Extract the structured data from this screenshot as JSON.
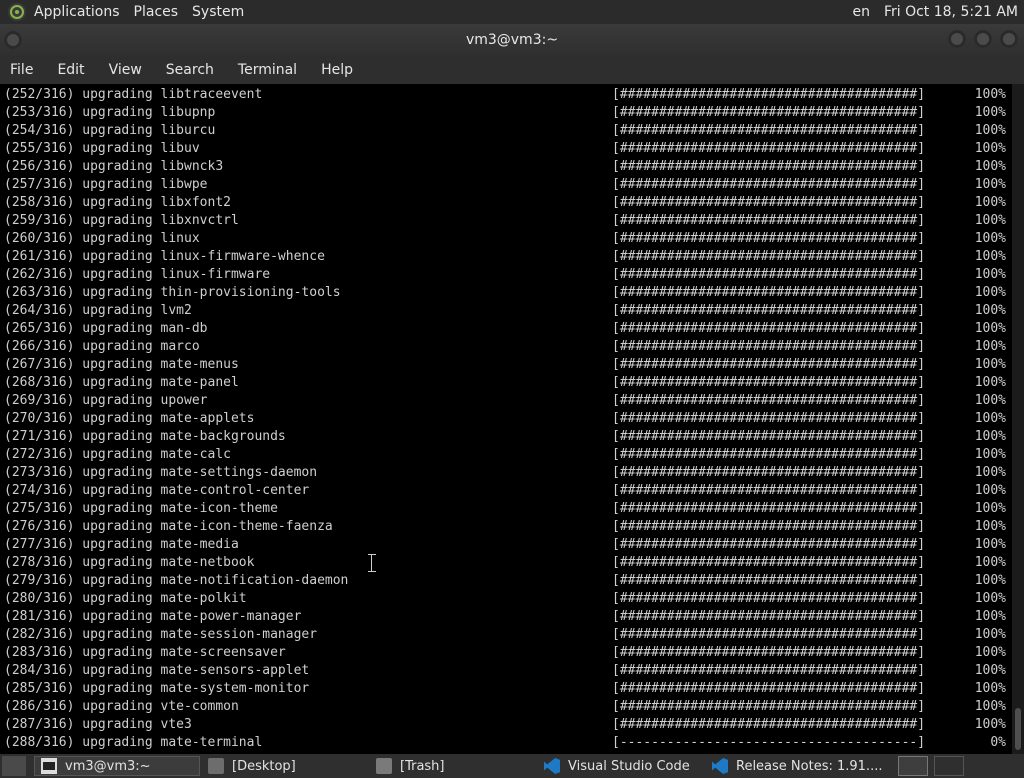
{
  "top_panel": {
    "menus": [
      "Applications",
      "Places",
      "System"
    ],
    "keyboard_layout": "en",
    "clock": "Fri Oct 18, 5:21 AM"
  },
  "window": {
    "title": "vm3@vm3:~"
  },
  "menubar": [
    "File",
    "Edit",
    "View",
    "Search",
    "Terminal",
    "Help"
  ],
  "terminal": {
    "lines": [
      {
        "text": "(252/316) upgrading libtraceevent",
        "bar": "[######################################]",
        "pct": "100%"
      },
      {
        "text": "(253/316) upgrading libupnp",
        "bar": "[######################################]",
        "pct": "100%"
      },
      {
        "text": "(254/316) upgrading liburcu",
        "bar": "[######################################]",
        "pct": "100%"
      },
      {
        "text": "(255/316) upgrading libuv",
        "bar": "[######################################]",
        "pct": "100%"
      },
      {
        "text": "(256/316) upgrading libwnck3",
        "bar": "[######################################]",
        "pct": "100%"
      },
      {
        "text": "(257/316) upgrading libwpe",
        "bar": "[######################################]",
        "pct": "100%"
      },
      {
        "text": "(258/316) upgrading libxfont2",
        "bar": "[######################################]",
        "pct": "100%"
      },
      {
        "text": "(259/316) upgrading libxnvctrl",
        "bar": "[######################################]",
        "pct": "100%"
      },
      {
        "text": "(260/316) upgrading linux",
        "bar": "[######################################]",
        "pct": "100%"
      },
      {
        "text": "(261/316) upgrading linux-firmware-whence",
        "bar": "[######################################]",
        "pct": "100%"
      },
      {
        "text": "(262/316) upgrading linux-firmware",
        "bar": "[######################################]",
        "pct": "100%"
      },
      {
        "text": "(263/316) upgrading thin-provisioning-tools",
        "bar": "[######################################]",
        "pct": "100%"
      },
      {
        "text": "(264/316) upgrading lvm2",
        "bar": "[######################################]",
        "pct": "100%"
      },
      {
        "text": "(265/316) upgrading man-db",
        "bar": "[######################################]",
        "pct": "100%"
      },
      {
        "text": "(266/316) upgrading marco",
        "bar": "[######################################]",
        "pct": "100%"
      },
      {
        "text": "(267/316) upgrading mate-menus",
        "bar": "[######################################]",
        "pct": "100%"
      },
      {
        "text": "(268/316) upgrading mate-panel",
        "bar": "[######################################]",
        "pct": "100%"
      },
      {
        "text": "(269/316) upgrading upower",
        "bar": "[######################################]",
        "pct": "100%"
      },
      {
        "text": "(270/316) upgrading mate-applets",
        "bar": "[######################################]",
        "pct": "100%"
      },
      {
        "text": "(271/316) upgrading mate-backgrounds",
        "bar": "[######################################]",
        "pct": "100%"
      },
      {
        "text": "(272/316) upgrading mate-calc",
        "bar": "[######################################]",
        "pct": "100%"
      },
      {
        "text": "(273/316) upgrading mate-settings-daemon",
        "bar": "[######################################]",
        "pct": "100%"
      },
      {
        "text": "(274/316) upgrading mate-control-center",
        "bar": "[######################################]",
        "pct": "100%"
      },
      {
        "text": "(275/316) upgrading mate-icon-theme",
        "bar": "[######################################]",
        "pct": "100%"
      },
      {
        "text": "(276/316) upgrading mate-icon-theme-faenza",
        "bar": "[######################################]",
        "pct": "100%"
      },
      {
        "text": "(277/316) upgrading mate-media",
        "bar": "[######################################]",
        "pct": "100%"
      },
      {
        "text": "(278/316) upgrading mate-netbook",
        "bar": "[######################################]",
        "pct": "100%"
      },
      {
        "text": "(279/316) upgrading mate-notification-daemon",
        "bar": "[######################################]",
        "pct": "100%"
      },
      {
        "text": "(280/316) upgrading mate-polkit",
        "bar": "[######################################]",
        "pct": "100%"
      },
      {
        "text": "(281/316) upgrading mate-power-manager",
        "bar": "[######################################]",
        "pct": "100%"
      },
      {
        "text": "(282/316) upgrading mate-session-manager",
        "bar": "[######################################]",
        "pct": "100%"
      },
      {
        "text": "(283/316) upgrading mate-screensaver",
        "bar": "[######################################]",
        "pct": "100%"
      },
      {
        "text": "(284/316) upgrading mate-sensors-applet",
        "bar": "[######################################]",
        "pct": "100%"
      },
      {
        "text": "(285/316) upgrading mate-system-monitor",
        "bar": "[######################################]",
        "pct": "100%"
      },
      {
        "text": "(286/316) upgrading vte-common",
        "bar": "[######################################]",
        "pct": "100%"
      },
      {
        "text": "(287/316) upgrading vte3",
        "bar": "[######################################]",
        "pct": "100%"
      },
      {
        "text": "(288/316) upgrading mate-terminal",
        "bar": "[--------------------------------------]",
        "pct": "0%"
      }
    ]
  },
  "taskbar": {
    "tasks": [
      {
        "label": "vm3@vm3:~",
        "icon": "terminal-icon"
      },
      {
        "label": "[Desktop]",
        "icon": "folder-icon"
      },
      {
        "label": "[Trash]",
        "icon": "trash-icon"
      },
      {
        "label": "Visual Studio Code",
        "icon": "vscode-icon"
      },
      {
        "label": "Release Notes: 1.91....",
        "icon": "vscode-icon"
      }
    ]
  }
}
